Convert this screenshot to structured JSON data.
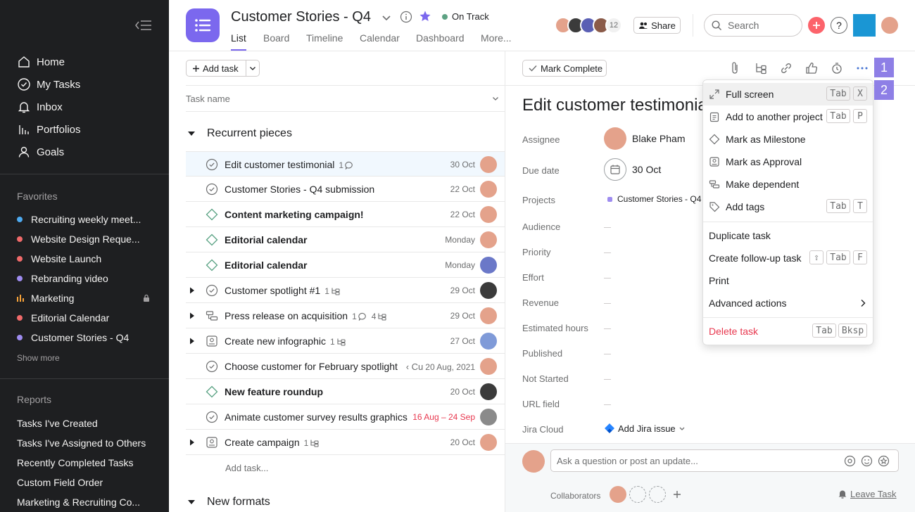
{
  "sidebar": {
    "nav": [
      {
        "label": "Home",
        "icon": "home-icon"
      },
      {
        "label": "My Tasks",
        "icon": "check-circle-icon"
      },
      {
        "label": "Inbox",
        "icon": "bell-icon"
      },
      {
        "label": "Portfolios",
        "icon": "bar-chart-icon"
      },
      {
        "label": "Goals",
        "icon": "person-icon"
      }
    ],
    "favorites_heading": "Favorites",
    "favorites": [
      {
        "label": "Recruiting weekly meet...",
        "color": "#4eaaf0"
      },
      {
        "label": "Website Design Reque...",
        "color": "#f06a6a"
      },
      {
        "label": "Website Launch",
        "color": "#f06a6a"
      },
      {
        "label": "Rebranding video",
        "color": "#9e8cf0"
      },
      {
        "label": "Marketing",
        "color": "#f8a33a"
      },
      {
        "label": "Editorial Calendar",
        "color": "#f06a6a"
      },
      {
        "label": "Customer Stories - Q4",
        "color": "#9e8cf0"
      }
    ],
    "show_more": "Show more",
    "reports_heading": "Reports",
    "reports": [
      "Tasks I've Created",
      "Tasks I've Assigned to Others",
      "Recently Completed Tasks",
      "Custom Field Order",
      "Marketing & Recruiting Co..."
    ]
  },
  "header": {
    "project_title": "Customer Stories - Q4",
    "status": "On Track",
    "status_color": "#5da283",
    "tabs": [
      "List",
      "Board",
      "Timeline",
      "Calendar",
      "Dashboard",
      "More..."
    ],
    "member_count": "12",
    "share_label": "Share",
    "search_placeholder": "Search",
    "help_label": "?"
  },
  "list": {
    "add_task_label": "Add task",
    "column_task_name": "Task name",
    "sections": [
      {
        "title": "Recurrent pieces"
      },
      {
        "title": "New formats"
      }
    ],
    "tasks": [
      {
        "name": "Edit customer testimonial",
        "comments": "1",
        "date": "30 Oct",
        "icon": "check-circle-icon"
      },
      {
        "name": "Customer Stories - Q4 submission",
        "date": "22 Oct",
        "icon": "check-circle-icon"
      },
      {
        "name": "Content  marketing campaign!",
        "date": "22 Oct",
        "icon": "milestone-diamond-icon"
      },
      {
        "name": "Editorial calendar",
        "date": "Monday",
        "icon": "milestone-diamond-icon"
      },
      {
        "name": "Editorial calendar",
        "date": "Monday",
        "icon": "milestone-diamond-icon"
      },
      {
        "name": "Customer spotlight #1",
        "subtasks": "1",
        "date": "29 Oct",
        "icon": "check-circle-icon"
      },
      {
        "name": "Press release on acquisition",
        "comments": "1",
        "subtasks": "4",
        "date": "29 Oct",
        "icon": "dependency-icon"
      },
      {
        "name": "Create new infographic",
        "subtasks": "1",
        "date": "27 Oct",
        "icon": "approval-icon"
      },
      {
        "name": "Choose customer for February spotlight",
        "date_prefix": "‹ Cu",
        "date": "20 Aug, 2021",
        "icon": "check-circle-icon"
      },
      {
        "name": "New feature roundup",
        "date": "20 Oct",
        "icon": "milestone-diamond-icon"
      },
      {
        "name": "Animate customer survey results graphics",
        "date": "16 Aug – 24 Sep",
        "date_color": "#e8384f",
        "icon": "check-circle-icon"
      },
      {
        "name": "Create campaign",
        "subtasks": "1",
        "date": "20 Oct",
        "icon": "approval-icon"
      }
    ],
    "add_task_inline": "Add task..."
  },
  "detail": {
    "mark_complete_label": "Mark Complete",
    "title": "Edit customer testimonial",
    "fields": {
      "assignee_label": "Assignee",
      "assignee_value": "Blake Pham",
      "due_label": "Due date",
      "due_value": "30 Oct",
      "projects_label": "Projects",
      "projects_value": "Customer Stories - Q4",
      "audience_label": "Audience",
      "priority_label": "Priority",
      "effort_label": "Effort",
      "revenue_label": "Revenue",
      "est_hours_label": "Estimated hours",
      "published_label": "Published",
      "not_started_label": "Not Started",
      "url_label": "URL field",
      "jira_label": "Jira Cloud",
      "jira_value": "Add Jira issue"
    },
    "comment_placeholder": "Ask a question or post an update...",
    "collaborators_label": "Collaborators",
    "leave_task_label": "Leave Task"
  },
  "menu": {
    "items": [
      {
        "label": "Full screen",
        "keys": [
          "Tab",
          "X"
        ],
        "icon": "expand-icon"
      },
      {
        "label": "Add to another project",
        "keys": [
          "Tab",
          "P"
        ],
        "icon": "clipboard-icon"
      },
      {
        "label": "Mark as Milestone",
        "icon": "milestone-diamond-icon"
      },
      {
        "label": "Mark as Approval",
        "icon": "approval-icon"
      },
      {
        "label": "Make dependent",
        "icon": "dependency-icon"
      },
      {
        "label": "Add tags",
        "keys": [
          "Tab",
          "T"
        ],
        "icon": "tag-icon"
      },
      {
        "label": "Duplicate task"
      },
      {
        "label": "Create follow-up task",
        "keys": [
          "⇧",
          "Tab",
          "F"
        ]
      },
      {
        "label": "Print"
      },
      {
        "label": "Advanced actions"
      },
      {
        "label": "Delete task",
        "keys": [
          "Tab",
          "Bksp"
        ],
        "color": "#e8384f"
      }
    ],
    "badges": [
      "1",
      "2"
    ]
  }
}
